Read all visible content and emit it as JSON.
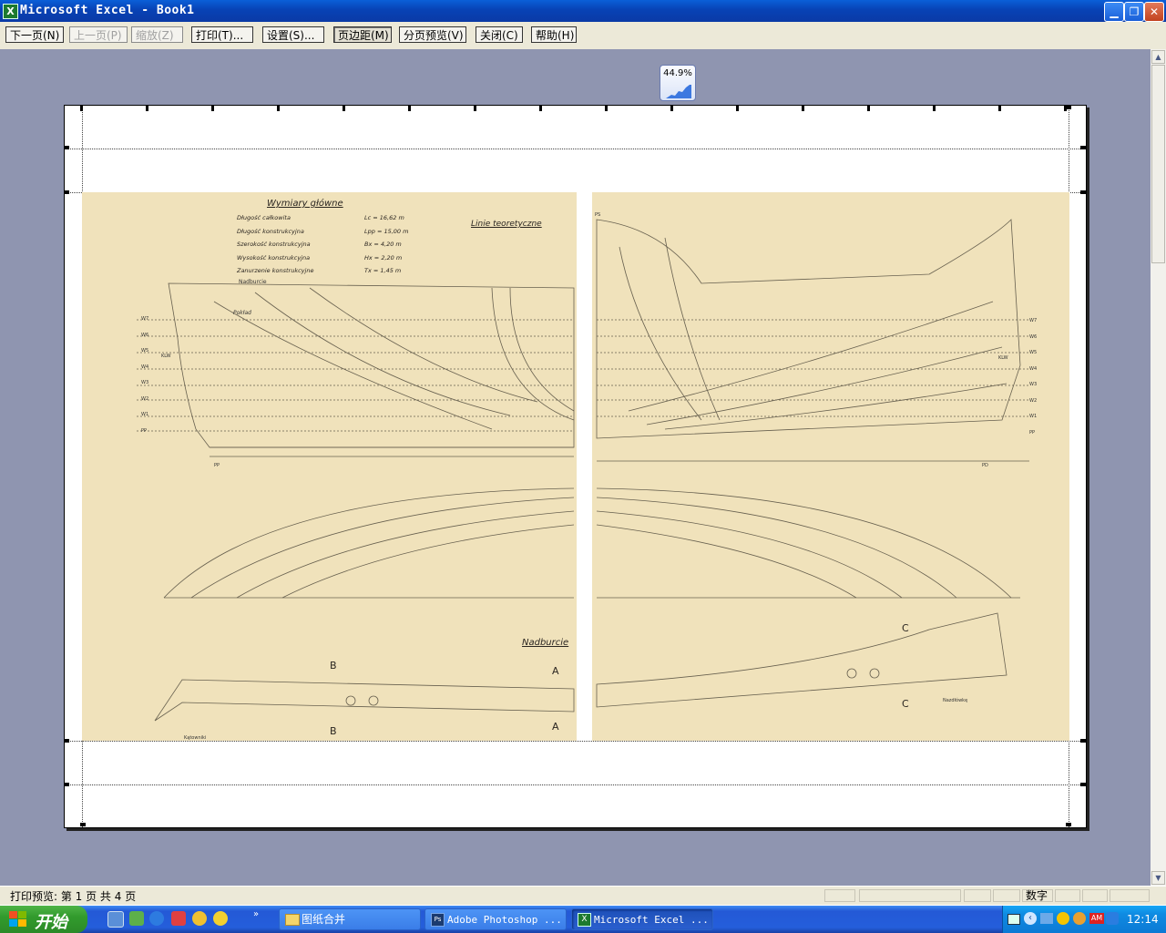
{
  "window": {
    "title": "Microsoft Excel - Book1",
    "app_icon": "excel-icon",
    "min_glyph": "▁",
    "restore_glyph": "❐",
    "close_glyph": "✕"
  },
  "toolbar": {
    "next_page": "下一页(N)",
    "prev_page": "上一页(P)",
    "zoom": "缩放(Z)",
    "print": "打印(T)...",
    "setup": "设置(S)...",
    "margins": "页边距(M)",
    "page_break_preview": "分页预览(V)",
    "close": "关闭(C)",
    "help": "帮助(H)"
  },
  "zoom_badge": {
    "value": "44.9%"
  },
  "drawing": {
    "title_main": "Wymiary główne",
    "title_lines": "Linie teoretyczne",
    "specs": [
      {
        "label": "Długość całkowita",
        "value": "Lc = 16,62 m"
      },
      {
        "label": "Długość konstrukcyjna",
        "value": "Lpp = 15,00 m"
      },
      {
        "label": "Szerokość konstrukcyjna",
        "value": "Bx = 4,20 m"
      },
      {
        "label": "Wysokość konstrukcyjna",
        "value": "Hx = 2,20 m"
      },
      {
        "label": "Zanurzenie konstrukcyjne",
        "value": "Tx = 1,45 m"
      }
    ],
    "bulwark_label": "Nadburcie",
    "nadburcie_small": "Nadburcie",
    "deck_label": "Pokład",
    "waterlines_left": [
      "W7",
      "W6",
      "W5",
      "W4",
      "W3",
      "W2",
      "W1",
      "PP"
    ],
    "waterlines_right": [
      "W7",
      "W6",
      "W5",
      "W4",
      "W3",
      "W2",
      "W1",
      "PP"
    ],
    "klw": "KLW",
    "section_a": "A",
    "section_b": "B",
    "section_c": "C",
    "katowniki": "Kątowniki",
    "nazdlowke": "Nazdłówkę",
    "ps": "PS",
    "pd": "PD",
    "pp": "PP"
  },
  "statusbar": {
    "text": "打印预览: 第 1 页  共 4 页",
    "mode": "数字"
  },
  "taskbar": {
    "start": "开始",
    "items": [
      {
        "label": "图纸合并",
        "icon": "folder-icon"
      },
      {
        "label": "Adobe Photoshop ...",
        "icon": "photoshop-icon"
      },
      {
        "label": "Microsoft Excel ...",
        "icon": "excel-icon"
      }
    ],
    "time": "12:14",
    "ime": "AM"
  }
}
